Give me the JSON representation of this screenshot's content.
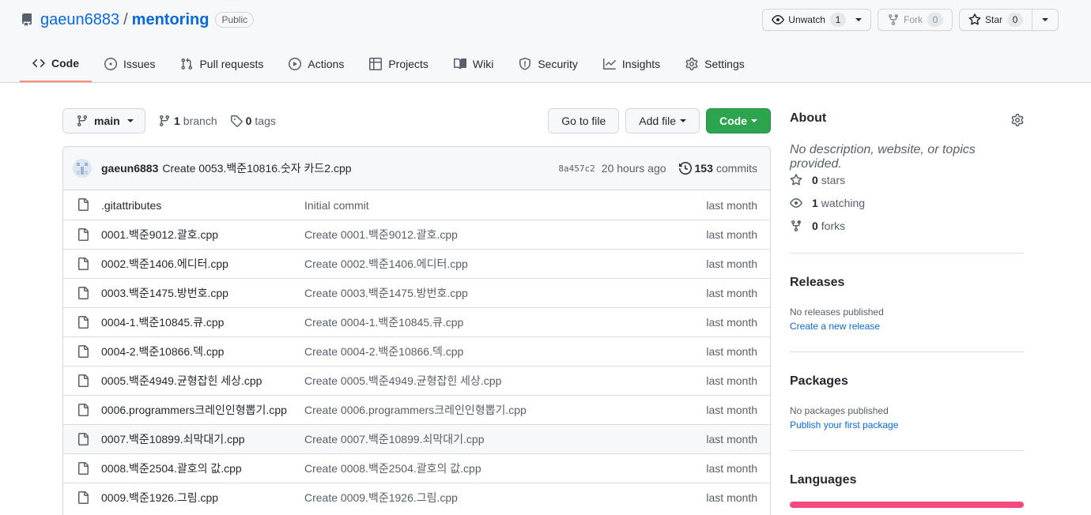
{
  "repo": {
    "owner": "gaeun6883",
    "separator": "/",
    "name": "mentoring",
    "visibility": "Public"
  },
  "actions": {
    "unwatch_label": "Unwatch",
    "unwatch_count": "1",
    "fork_label": "Fork",
    "fork_count": "0",
    "star_label": "Star",
    "star_count": "0"
  },
  "tabs": [
    {
      "label": "Code",
      "icon": "code-icon"
    },
    {
      "label": "Issues",
      "icon": "issue-icon"
    },
    {
      "label": "Pull requests",
      "icon": "pull-request-icon"
    },
    {
      "label": "Actions",
      "icon": "play-icon"
    },
    {
      "label": "Projects",
      "icon": "table-icon"
    },
    {
      "label": "Wiki",
      "icon": "book-icon"
    },
    {
      "label": "Security",
      "icon": "shield-icon"
    },
    {
      "label": "Insights",
      "icon": "graph-icon"
    },
    {
      "label": "Settings",
      "icon": "gear-icon"
    }
  ],
  "branch": {
    "current": "main",
    "branch_count": "1",
    "branch_label": "branch",
    "tag_count": "0",
    "tag_label": "tags"
  },
  "buttons": {
    "go_to_file": "Go to file",
    "add_file": "Add file",
    "code": "Code"
  },
  "latest_commit": {
    "author": "gaeun6883",
    "message": "Create 0053.백준10816.숫자 카드2.cpp",
    "sha": "8a457c2",
    "time": "20 hours ago",
    "count": "153",
    "count_label": "commits"
  },
  "files": [
    {
      "name": ".gitattributes",
      "message": "Initial commit",
      "age": "last month"
    },
    {
      "name": "0001.백준9012.괄호.cpp",
      "message": "Create 0001.백준9012.괄호.cpp",
      "age": "last month"
    },
    {
      "name": "0002.백준1406.에디터.cpp",
      "message": "Create 0002.백준1406.에디터.cpp",
      "age": "last month"
    },
    {
      "name": "0003.백준1475.방번호.cpp",
      "message": "Create 0003.백준1475.방번호.cpp",
      "age": "last month"
    },
    {
      "name": "0004-1.백준10845.큐.cpp",
      "message": "Create 0004-1.백준10845.큐.cpp",
      "age": "last month"
    },
    {
      "name": "0004-2.백준10866.덱.cpp",
      "message": "Create 0004-2.백준10866.덱.cpp",
      "age": "last month"
    },
    {
      "name": "0005.백준4949.균형잡힌 세상.cpp",
      "message": "Create 0005.백준4949.균형잡힌 세상.cpp",
      "age": "last month"
    },
    {
      "name": "0006.programmers크레인인형뽑기.cpp",
      "message": "Create 0006.programmers크레인인형뽑기.cpp",
      "age": "last month"
    },
    {
      "name": "0007.백준10899.쇠막대기.cpp",
      "message": "Create 0007.백준10899.쇠막대기.cpp",
      "age": "last month"
    },
    {
      "name": "0008.백준2504.괄호의 값.cpp",
      "message": "Create 0008.백준2504.괄호의 값.cpp",
      "age": "last month"
    },
    {
      "name": "0009.백준1926.그림.cpp",
      "message": "Create 0009.백준1926.그림.cpp",
      "age": "last month"
    }
  ],
  "about": {
    "title": "About",
    "description": "No description, website, or topics provided.",
    "stars_count": "0",
    "stars_label": "stars",
    "watching_count": "1",
    "watching_label": "watching",
    "forks_count": "0",
    "forks_label": "forks"
  },
  "releases": {
    "title": "Releases",
    "empty_text": "No releases published",
    "link": "Create a new release"
  },
  "packages": {
    "title": "Packages",
    "empty_text": "No packages published",
    "link": "Publish your first package"
  },
  "languages": {
    "title": "Languages",
    "bar_color": "#f34b7d"
  },
  "colors": {
    "accent": "#0969da",
    "green_button": "#2da44e",
    "tab_underline": "#fd8c73"
  }
}
